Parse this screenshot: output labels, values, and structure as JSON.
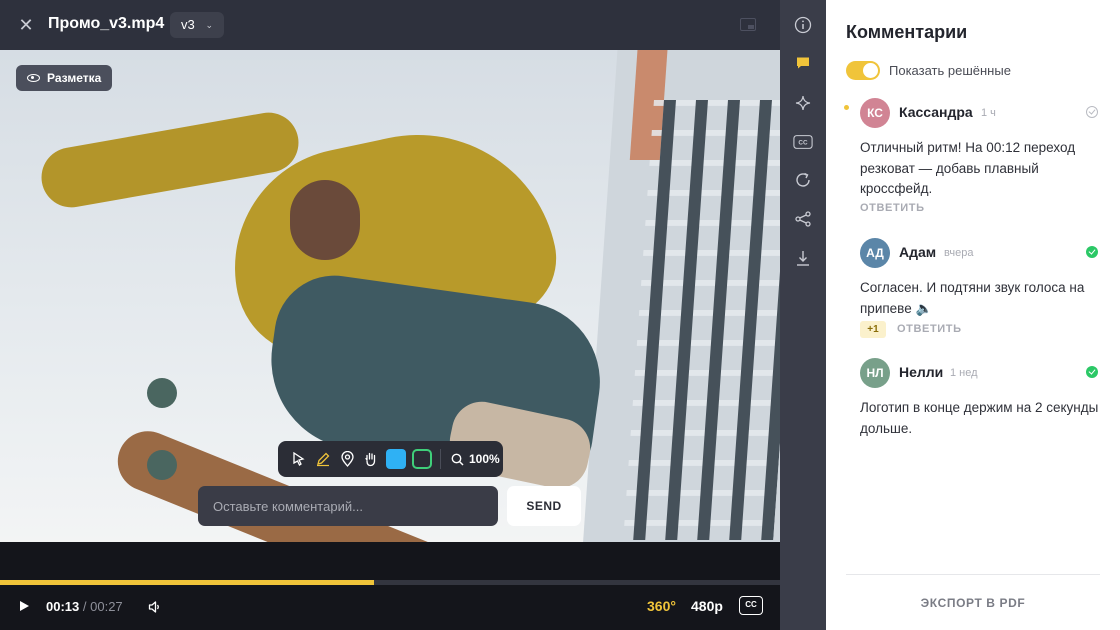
{
  "header": {
    "file_name": "Промо_v3.mp4",
    "version": "v3"
  },
  "video": {
    "markup_label": "Разметка",
    "zoom": "100%",
    "comment_placeholder": "Оставьте комментарий...",
    "send_label": "SEND",
    "swatch_fill_color": "#2fb1f4",
    "swatch_outline_color": "#3fcf7a"
  },
  "playback": {
    "current_time": "00:13",
    "separator": "/",
    "total_time": "00:27",
    "progress": 0.48,
    "mode_360": "360°",
    "quality": "480p",
    "cc": "CC"
  },
  "rail": {
    "icons": [
      "info-icon",
      "comments-icon",
      "sparkle-icon",
      "cc-icon",
      "refresh-icon",
      "share-icon",
      "download-icon"
    ]
  },
  "comments": {
    "title": "Комментарии",
    "show_resolved_label": "Показать решённые",
    "items": [
      {
        "initials": "КС",
        "avatar_color": "#d18494",
        "author": "Кассандра",
        "time": "1 ч",
        "text": "Отличный ритм! На 00:12 переход резковат — добавь плавный кроссфейд.",
        "reply_label": "ОТВЕТИТЬ",
        "resolved": false
      },
      {
        "initials": "АД",
        "avatar_color": "#5b86a8",
        "author": "Адам",
        "time": "вчера",
        "text": "Согласен. И подтяни звук голоса на припеве 🔈",
        "reaction": "+1",
        "reply_label": "ОТВЕТИТЬ",
        "resolved": true
      },
      {
        "initials": "НЛ",
        "avatar_color": "#78a08a",
        "author": "Нелли",
        "time": "1 нед",
        "text": "Логотип в конце держим на 2 секунды дольше.",
        "resolved": true
      }
    ],
    "export_label": "ЭКСПОРТ В PDF"
  },
  "colors": {
    "accent": "#f0c43a",
    "resolved": "#2bc866"
  }
}
